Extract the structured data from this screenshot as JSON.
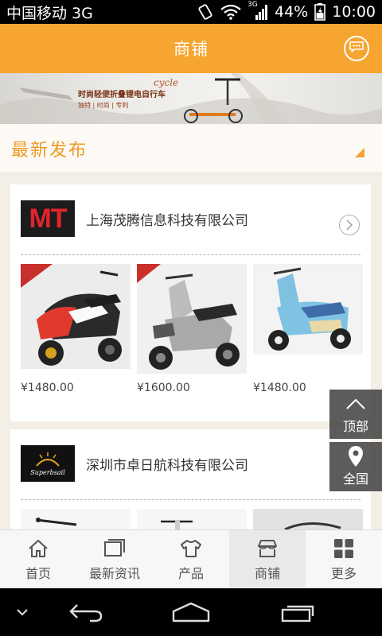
{
  "status_bar": {
    "carrier": "中国移动 3G",
    "network_label": "3G",
    "battery": "44%",
    "time": "10:00"
  },
  "header": {
    "title": "商铺"
  },
  "banner": {
    "headline": "时尚轻便折叠锂电自行车",
    "tagline": "独特 | 时尚 | 专利",
    "script_word": "cycle"
  },
  "section": {
    "title": "最新发布"
  },
  "shops": [
    {
      "logo_text": "MT",
      "name": "上海茂腾信息科技有限公司",
      "products": [
        {
          "price": "¥1480.00"
        },
        {
          "price": "¥1600.00"
        },
        {
          "price": "¥1480.00"
        }
      ]
    },
    {
      "logo_text": "Superbsail",
      "name": "深圳市卓日航科技有限公司"
    }
  ],
  "float_buttons": {
    "top_label": "顶部",
    "all_label": "全国"
  },
  "tabs": [
    {
      "label": "首页",
      "icon": "home-icon"
    },
    {
      "label": "最新资讯",
      "icon": "news-icon"
    },
    {
      "label": "产品",
      "icon": "tshirt-icon"
    },
    {
      "label": "商铺",
      "icon": "store-icon",
      "active": true
    },
    {
      "label": "更多",
      "icon": "grid-icon"
    }
  ],
  "colors": {
    "accent": "#f6a530",
    "section_title": "#ee9a25"
  }
}
